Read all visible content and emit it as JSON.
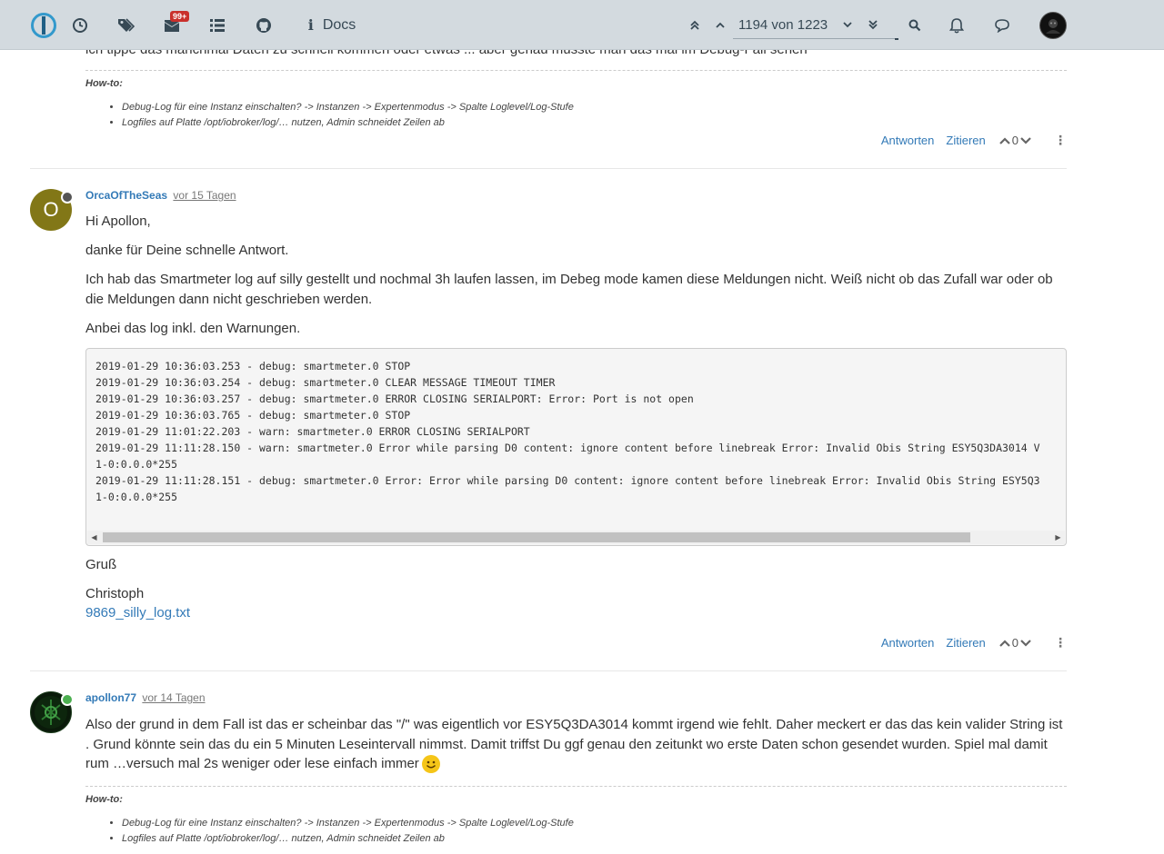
{
  "nav": {
    "docs_label": "Docs",
    "badge": "99+",
    "pagination": "1194 von 1223"
  },
  "top_post": {
    "cut_text": "ich tippe das manchmal Daten zu schnell kommen oder etwas ... aber genau müsste man das mal im Debug-Fall sehen",
    "howto_label": "How-to:",
    "howto_items": [
      "Debug-Log für eine Instanz einschalten? -> Instanzen -> Expertenmodus -> Spalte Loglevel/Log-Stufe",
      "Logfiles auf Platte /opt/iobroker/log/… nutzen, Admin schneidet Zeilen ab"
    ],
    "reply_label": "Antworten",
    "quote_label": "Zitieren",
    "votes": "0"
  },
  "post1": {
    "avatar_letter": "O",
    "avatar_color": "#827717",
    "status_color": "#555555",
    "author": "OrcaOfTheSeas",
    "time": "vor 15 Tagen",
    "paragraphs": [
      "Hi Apollon,",
      "danke für Deine schnelle Antwort.",
      "Ich hab das Smartmeter log auf silly gestellt und nochmal 3h laufen lassen, im Debeg mode kamen diese Meldungen nicht. Weiß nicht ob das Zufall war oder ob die Meldungen dann nicht geschrieben werden.",
      "Anbei das log inkl. den Warnungen."
    ],
    "code": "2019-01-29 10:36:03.253 - debug: smartmeter.0 STOP\n2019-01-29 10:36:03.254 - debug: smartmeter.0 CLEAR MESSAGE TIMEOUT TIMER\n2019-01-29 10:36:03.257 - debug: smartmeter.0 ERROR CLOSING SERIALPORT: Error: Port is not open\n2019-01-29 10:36:03.765 - debug: smartmeter.0 STOP\n2019-01-29 11:01:22.203 - warn: smartmeter.0 ERROR CLOSING SERIALPORT\n2019-01-29 11:11:28.150 - warn: smartmeter.0 Error while parsing D0 content: ignore content before linebreak Error: Invalid Obis String ESY5Q3DA3014 V\n1-0:0.0.0*255\n2019-01-29 11:11:28.151 - debug: smartmeter.0 Error: Error while parsing D0 content: ignore content before linebreak Error: Invalid Obis String ESY5Q3\n1-0:0.0.0*255",
    "greeting": "Gruß",
    "signature": "Christoph",
    "attachment": "9869_silly_log.txt",
    "reply_label": "Antworten",
    "quote_label": "Zitieren",
    "votes": "0"
  },
  "post2": {
    "status_color": "#4caf50",
    "author": "apollon77",
    "time": "vor 14 Tagen",
    "text": "Also der grund in dem Fall ist das er scheinbar das \"/\" was eigentlich vor ESY5Q3DA3014 kommt irgend wie fehlt. Daher meckert er das das kein valider String ist . Grund könnte sein das du ein 5 Minuten Leseintervall nimmst. Damit triffst Du ggf genau den zeitunkt wo erste Daten schon gesendet wurden. Spiel mal damit rum …versuch mal 2s weniger oder lese einfach immer",
    "howto_label": "How-to:",
    "howto_items": [
      "Debug-Log für eine Instanz einschalten? -> Instanzen -> Expertenmodus -> Spalte Loglevel/Log-Stufe",
      "Logfiles auf Platte /opt/iobroker/log/… nutzen, Admin schneidet Zeilen ab"
    ]
  }
}
